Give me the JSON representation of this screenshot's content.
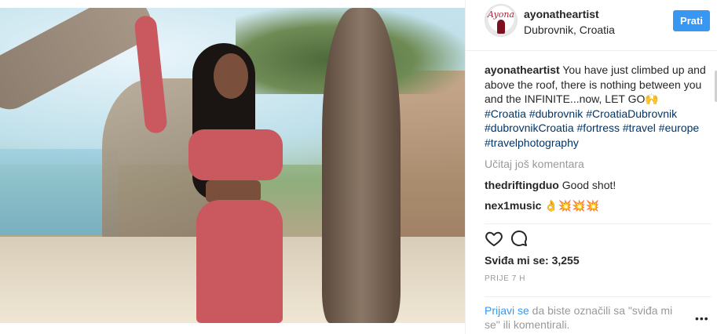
{
  "post": {
    "username": "ayonatheartist",
    "location": "Dubrovnik, Croatia",
    "follow_label": "Prati",
    "avatar_logo_text": "Ayona",
    "caption": {
      "username": "ayonatheartist",
      "text": "You have just climbed up and above the roof, there is nothing between you and the INFINITE...now, LET GO",
      "emoji": "🙌",
      "hashtags": [
        "#Croatia",
        "#dubrovnik",
        "#CroatiaDubrovnik",
        "#dubrovnikCroatia",
        "#fortress",
        "#travel",
        "#europe",
        "#travelphotography"
      ]
    },
    "load_more": "Učitaj još komentara",
    "comments": [
      {
        "username": "thedriftingduo",
        "text": "Good shot!"
      },
      {
        "username": "nex1music",
        "text": "👌💥💥💥"
      }
    ],
    "likes": "Sviđa mi se: 3,255",
    "time": "PRIJE 7 H",
    "login_prompt": {
      "link": "Prijavi se",
      "text": " da biste označili sa \"sviđa mi se\" ili komentirali."
    },
    "more_label": "•••"
  },
  "icons": {
    "like": "heart-icon",
    "comment": "comment-icon"
  },
  "colors": {
    "accent": "#3897f0",
    "hashtag": "#003569",
    "muted": "#999999",
    "text": "#262626"
  }
}
